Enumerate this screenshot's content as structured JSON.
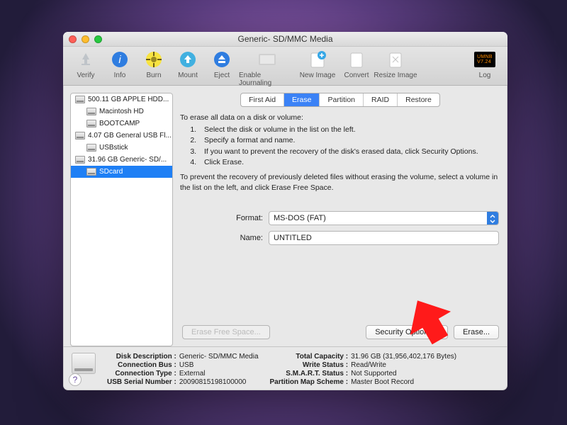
{
  "window": {
    "title": "Generic- SD/MMC Media"
  },
  "toolbar": {
    "verify": "Verify",
    "info": "Info",
    "burn": "Burn",
    "mount": "Mount",
    "eject": "Eject",
    "journaling": "Enable Journaling",
    "new_image": "New Image",
    "convert": "Convert",
    "resize": "Resize Image",
    "log": "Log"
  },
  "sidebar": {
    "items": [
      {
        "label": "500.11 GB APPLE HDD...",
        "indent": false
      },
      {
        "label": "Macintosh HD",
        "indent": true
      },
      {
        "label": "BOOTCAMP",
        "indent": true
      },
      {
        "label": "4.07 GB General USB Fl...",
        "indent": false
      },
      {
        "label": "USBstick",
        "indent": true
      },
      {
        "label": "31.96 GB Generic- SD/...",
        "indent": false
      },
      {
        "label": "SDcard",
        "indent": true,
        "selected": true
      }
    ]
  },
  "tabs": {
    "first_aid": "First Aid",
    "erase": "Erase",
    "partition": "Partition",
    "raid": "RAID",
    "restore": "Restore"
  },
  "instructions": {
    "intro": "To erase all data on a disk or volume:",
    "steps": [
      "Select the disk or volume in the list on the left.",
      "Specify a format and name.",
      "If you want to prevent the recovery of the disk's erased data, click Security Options.",
      "Click Erase."
    ],
    "note": "To prevent the recovery of previously deleted files without erasing the volume, select a volume in the list on the left, and click Erase Free Space."
  },
  "form": {
    "format_label": "Format:",
    "format_value": "MS-DOS (FAT)",
    "name_label": "Name:",
    "name_value": "UNTITLED"
  },
  "buttons": {
    "efs": "Erase Free Space...",
    "security": "Security Options...",
    "erase": "Erase..."
  },
  "footer": {
    "l1k": "Disk Description :",
    "l1v": "Generic- SD/MMC Media",
    "l2k": "Connection Bus :",
    "l2v": "USB",
    "l3k": "Connection Type :",
    "l3v": "External",
    "l4k": "USB Serial Number :",
    "l4v": "20090815198100000",
    "r1k": "Total Capacity :",
    "r1v": "31.96 GB (31,956,402,176 Bytes)",
    "r2k": "Write Status :",
    "r2v": "Read/Write",
    "r3k": "S.M.A.R.T. Status :",
    "r3v": "Not Supported",
    "r4k": "Partition Map Scheme :",
    "r4v": "Master Boot Record"
  }
}
